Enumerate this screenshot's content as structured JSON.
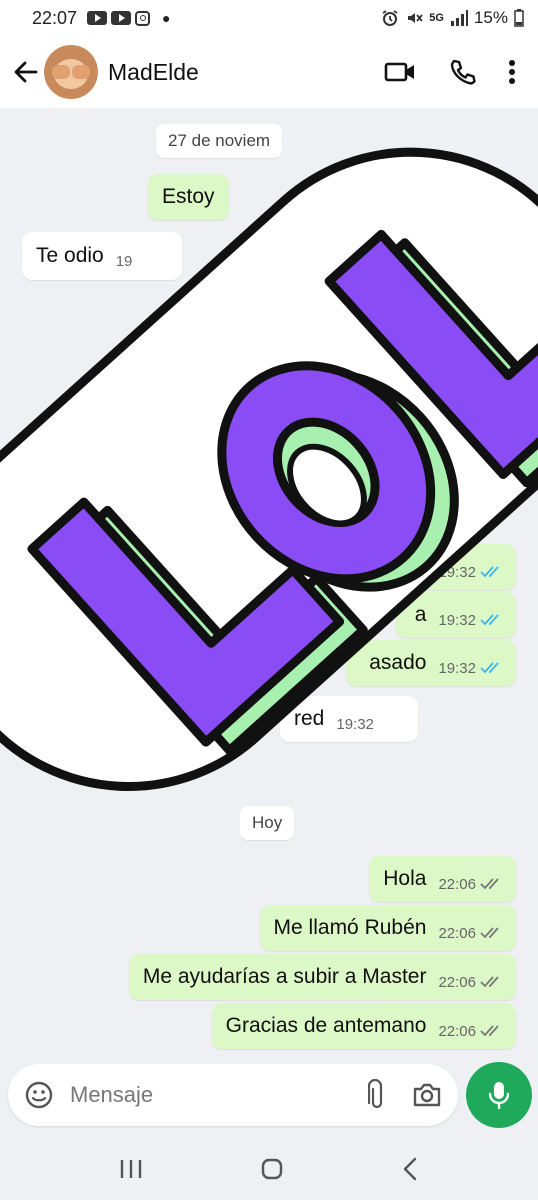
{
  "status_bar": {
    "time": "22:07",
    "network": "5G",
    "battery": "15%",
    "icons": [
      "youtube-icon",
      "youtube-icon",
      "instagram-icon",
      "alarm-icon",
      "mute-icon",
      "signal-icon",
      "battery-icon"
    ]
  },
  "header": {
    "contact_name": "MadElde",
    "icons": [
      "back-arrow-icon",
      "video-call-icon",
      "phone-icon",
      "more-vert-icon"
    ]
  },
  "chat": {
    "date_chips": [
      "27 de noviem",
      "Hoy"
    ],
    "messages_before": [
      {
        "direction": "out",
        "text": "Estoy",
        "time": ""
      },
      {
        "direction": "in",
        "text": "Te odio",
        "time": "19"
      },
      {
        "direction": "out",
        "text": "",
        "time": "19:32"
      },
      {
        "direction": "out",
        "text": "a",
        "time": "19:32"
      },
      {
        "direction": "out",
        "text": "asado",
        "time": "19:32"
      },
      {
        "direction": "in",
        "text": "red",
        "time": "19:32"
      }
    ],
    "messages_today": [
      {
        "direction": "out",
        "text": "Hola",
        "time": "22:06"
      },
      {
        "direction": "out",
        "text": "Me llamó Rubén",
        "time": "22:06"
      },
      {
        "direction": "out",
        "text": "Me ayudarías a subir a Master",
        "time": "22:06"
      },
      {
        "direction": "out",
        "text": "Gracias de antemano",
        "time": "22:06"
      }
    ]
  },
  "sticker": {
    "text": "LOL",
    "letter_color": "#8a4cf5",
    "shadow_color": "#a8f0b0"
  },
  "input_bar": {
    "placeholder": "Mensaje",
    "icons": [
      "emoji-icon",
      "attach-icon",
      "camera-icon",
      "mic-icon"
    ]
  },
  "colors": {
    "outgoing_bubble": "#dcf8c6",
    "incoming_bubble": "#ffffff",
    "background": "#eef0f3",
    "accent": "#1faa5b",
    "read_ticks": "#34b7f1"
  },
  "nav_bar": {
    "icons": [
      "recents-icon",
      "home-icon",
      "back-icon"
    ]
  }
}
